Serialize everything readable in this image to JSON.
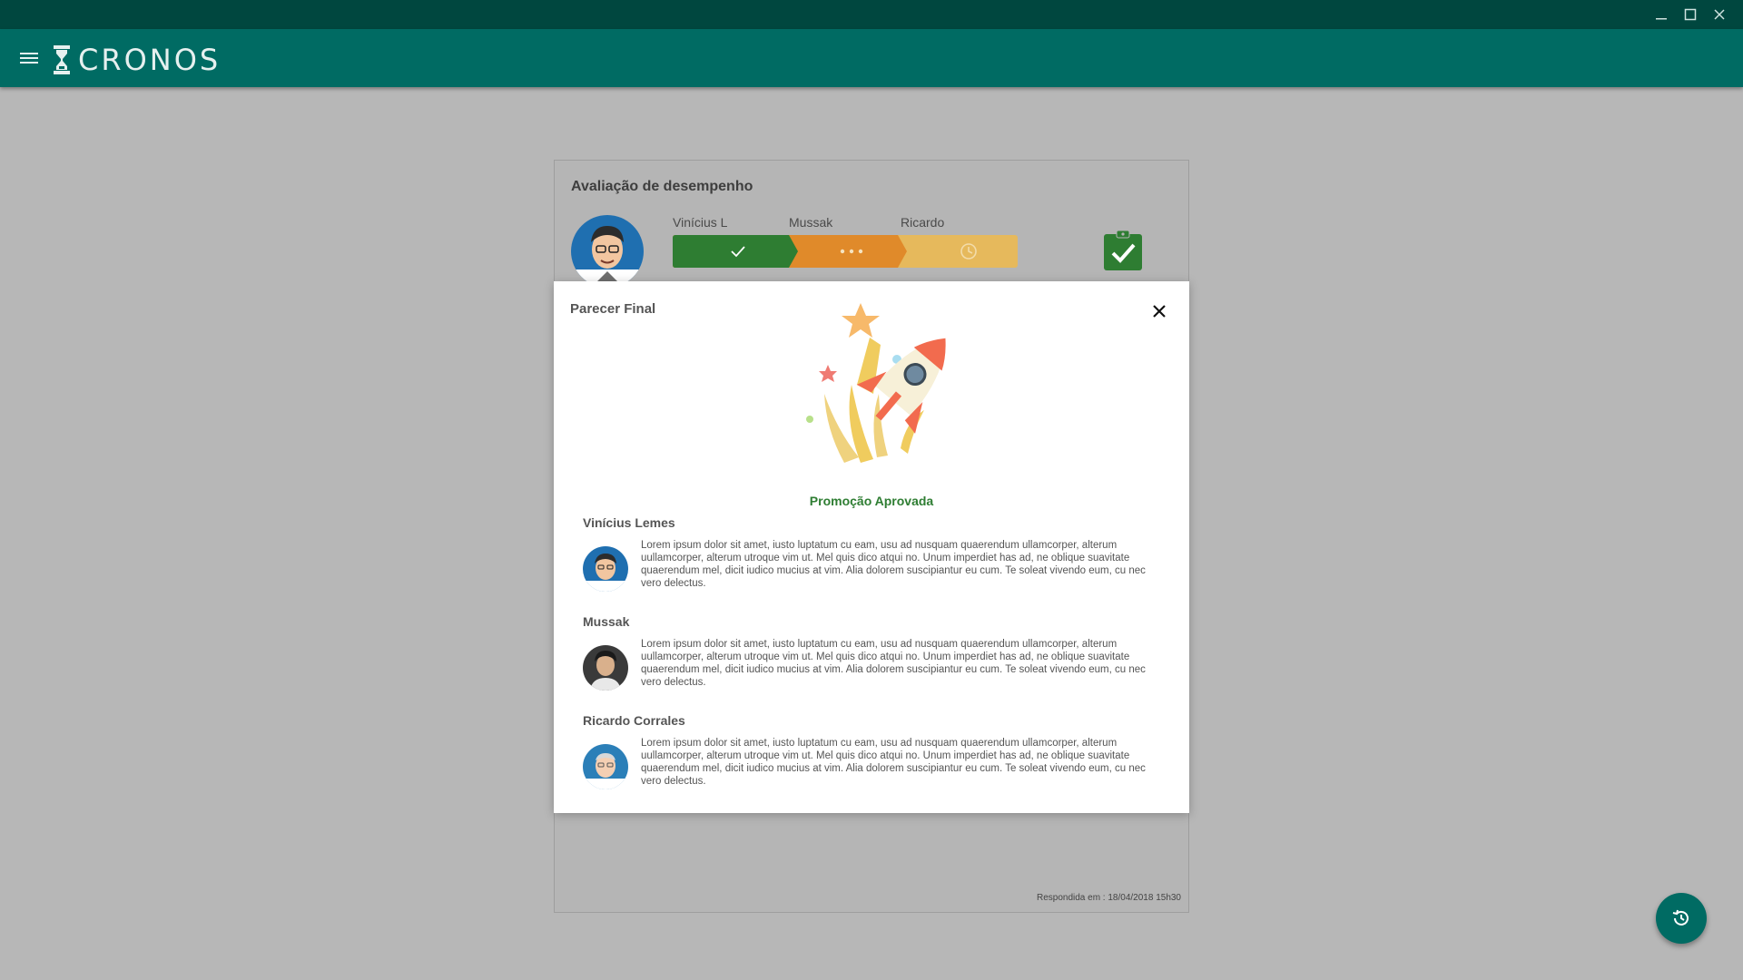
{
  "app": {
    "logo_text": "CRONOS"
  },
  "evaluation": {
    "title": "Avaliação de desempenho",
    "steps": [
      {
        "name": "Vinícius L",
        "status": "done"
      },
      {
        "name": "Mussak",
        "status": "in-progress"
      },
      {
        "name": "Ricardo",
        "status": "pending"
      }
    ],
    "answered_at": "Respondida em : 18/04/2018 15h30"
  },
  "modal": {
    "title": "Parecer Final",
    "status": "Promoção Aprovada",
    "reviews": [
      {
        "name": "Vinícius Lemes",
        "text": "Lorem ipsum dolor sit amet, iusto luptatum cu eam, usu ad nusquam quaerendum ullamcorper, alterum uullamcorper, alterum utroque vim ut. Mel quis dico atqui no. Unum imperdiet has ad, ne oblique suavitate quaerendum mel, dicit iudico mucius at vim. Alia dolorem suscipiantur eu cum. Te soleat vivendo eum, cu nec vero delectus."
      },
      {
        "name": "Mussak",
        "text": "Lorem ipsum dolor sit amet, iusto luptatum cu eam, usu ad nusquam quaerendum ullamcorper, alterum uullamcorper, alterum utroque vim ut. Mel quis dico atqui no. Unum imperdiet has ad, ne oblique suavitate quaerendum mel, dicit iudico mucius at vim. Alia dolorem suscipiantur eu cum. Te soleat vivendo eum, cu nec vero delectus."
      },
      {
        "name": "Ricardo Corrales",
        "text": "Lorem ipsum dolor sit amet, iusto luptatum cu eam, usu ad nusquam quaerendum ullamcorper, alterum uullamcorper, alterum utroque vim ut. Mel quis dico atqui no. Unum imperdiet has ad, ne oblique suavitate quaerendum mel, dicit iudico mucius at vim. Alia dolorem suscipiantur eu cum. Te soleat vivendo eum, cu nec vero delectus."
      }
    ]
  },
  "icons": {
    "window": [
      "minimize-icon",
      "maximize-icon",
      "close-icon"
    ],
    "menu": "hamburger-icon",
    "logo": "hourglass-icon",
    "completed": "clipboard-check-icon",
    "fab": "history-icon"
  },
  "colors": {
    "titlebar": "#00473f",
    "appbar": "#006b63",
    "step_done": "#2e7d32",
    "step_progress": "#e08a2a",
    "step_pending": "#e6b95c",
    "status_text": "#2e7d32"
  }
}
